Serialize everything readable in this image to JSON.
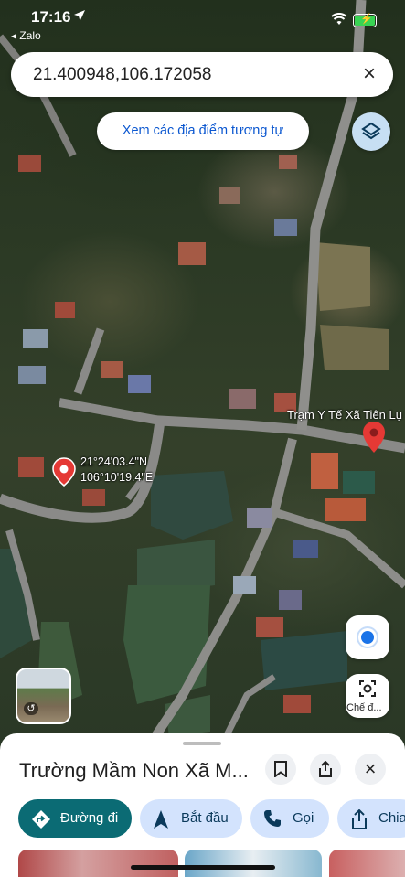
{
  "status_bar": {
    "time": "17:16",
    "back_app": "◂ Zalo"
  },
  "search": {
    "query": "21.400948,106.172058",
    "close_icon": "close-icon"
  },
  "similar_places": {
    "label": "Xem các địa điểm tương tự"
  },
  "map": {
    "coordinates_label": {
      "lat": "21°24'03.4\"N",
      "lng": "106°10'19.4\"E"
    },
    "place_label": "Trạm Y Tế Xã Tiên Lụ",
    "lens_label": "Chế đ..."
  },
  "sheet": {
    "title": "Trường Mầm Non Xã M...",
    "actions": [
      {
        "label": "Đường đi",
        "icon": "directions-icon",
        "primary": true
      },
      {
        "label": "Bắt đầu",
        "icon": "navigation-arrow-icon",
        "primary": false
      },
      {
        "label": "Gọi",
        "icon": "phone-icon",
        "primary": false
      },
      {
        "label": "Chia",
        "icon": "share-icon",
        "primary": false
      }
    ]
  },
  "colors": {
    "primary_action": "#0b6b74",
    "secondary_action": "#d3e3fd",
    "place_pin": "#e53935",
    "link_text": "#0b57d0"
  }
}
